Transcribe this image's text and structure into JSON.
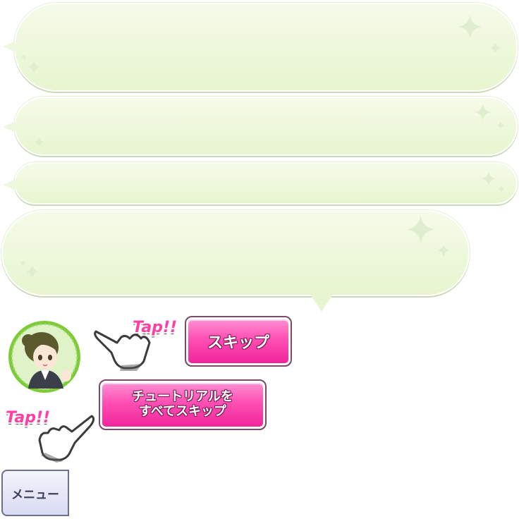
{
  "tutorial": {
    "skip_label": "スキップ",
    "skip_all_label_line1": "チュートリアルを",
    "skip_all_label_line2": "すべてスキップ",
    "tap_label_1": "Tap!!",
    "tap_label_2": "Tap!!"
  },
  "menu": {
    "label": "メニュー"
  },
  "icons": {
    "sparkle": "sparkle-icon",
    "pointer_hand": "pointing-hand-icon",
    "avatar": "character-avatar"
  },
  "colors": {
    "bubble_fill": "#ecf7dc",
    "button_pink": "#ff4fb3",
    "avatar_ring": "#7ecb3a"
  }
}
